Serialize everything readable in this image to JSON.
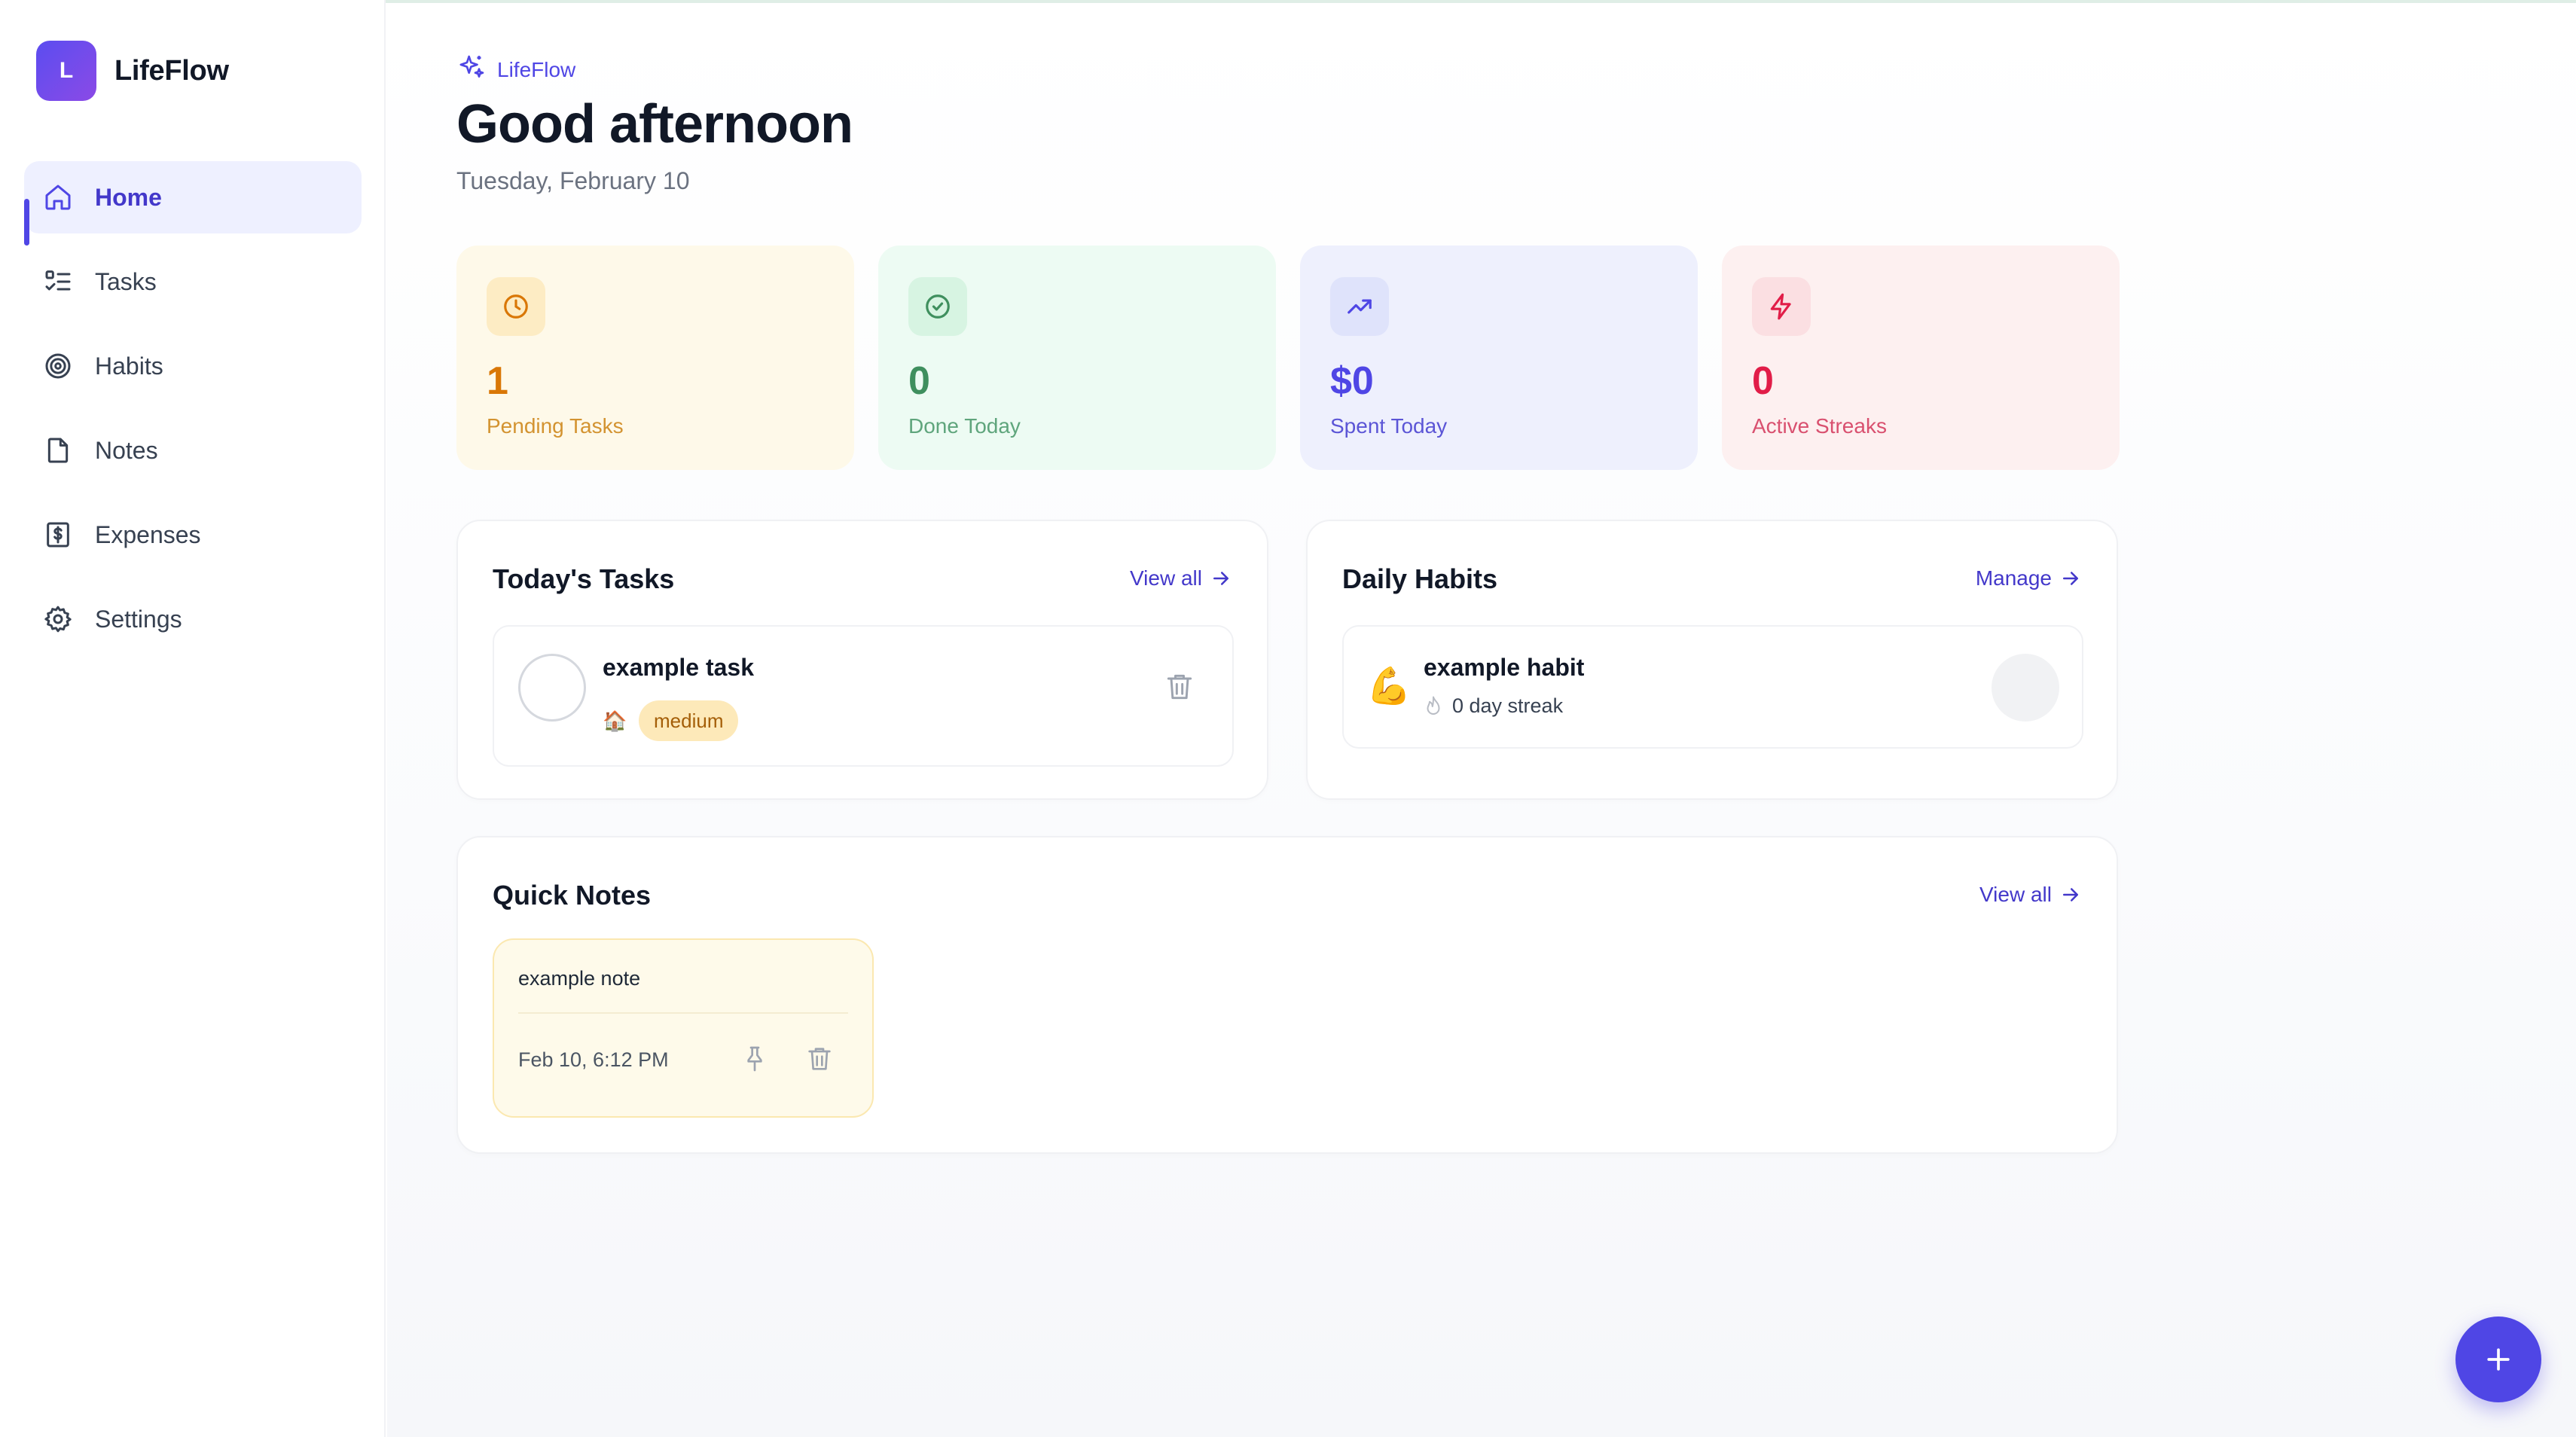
{
  "app": {
    "logo_letter": "L",
    "name": "LifeFlow"
  },
  "sidebar": {
    "items": [
      {
        "label": "Home",
        "icon": "home-icon",
        "active": true
      },
      {
        "label": "Tasks",
        "icon": "list-checks-icon",
        "active": false
      },
      {
        "label": "Habits",
        "icon": "target-icon",
        "active": false
      },
      {
        "label": "Notes",
        "icon": "file-icon",
        "active": false
      },
      {
        "label": "Expenses",
        "icon": "receipt-dollar-icon",
        "active": false
      },
      {
        "label": "Settings",
        "icon": "gear-icon",
        "active": false
      }
    ]
  },
  "header": {
    "crumb": "LifeFlow",
    "crumb_icon": "sparkles-icon",
    "greeting": "Good afternoon",
    "date": "Tuesday, February 10"
  },
  "stats": [
    {
      "value": "1",
      "label": "Pending Tasks",
      "icon": "clock-icon",
      "color": "#d97706"
    },
    {
      "value": "0",
      "label": "Done Today",
      "icon": "check-circle-icon",
      "color": "#3f8f5e"
    },
    {
      "value": "$0",
      "label": "Spent Today",
      "icon": "trending-up-icon",
      "color": "#4f46e5"
    },
    {
      "value": "0",
      "label": "Active Streaks",
      "icon": "zap-icon",
      "color": "#e11d48"
    }
  ],
  "tasks": {
    "title": "Today's Tasks",
    "link": "View all",
    "items": [
      {
        "name": "example task",
        "category_emoji": "🏠",
        "priority": "medium"
      }
    ]
  },
  "habits": {
    "title": "Daily Habits",
    "link": "Manage",
    "items": [
      {
        "emoji": "💪",
        "name": "example habit",
        "streak": "0 day streak"
      }
    ]
  },
  "notes": {
    "title": "Quick Notes",
    "link": "View all",
    "items": [
      {
        "text": "example note",
        "time": "Feb 10, 6:12 PM"
      }
    ]
  },
  "colors": {
    "accent": "#4f46e5",
    "accent_dark": "#4338ca"
  }
}
